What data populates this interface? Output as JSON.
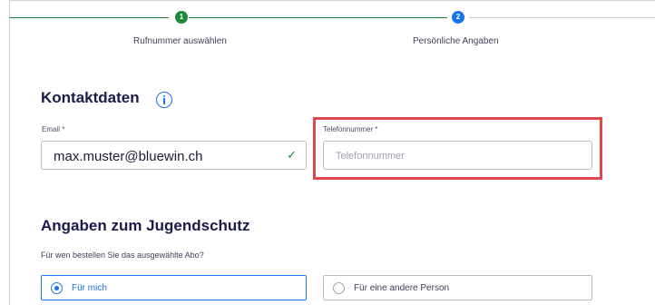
{
  "stepper": {
    "steps": [
      {
        "number": "1",
        "label": "Rufnummer auswählen",
        "state": "done"
      },
      {
        "number": "2",
        "label": "Persönliche Angaben",
        "state": "active"
      }
    ]
  },
  "contact": {
    "heading": "Kontaktdaten",
    "info_icon": "info-icon",
    "email": {
      "label": "Email *",
      "value": "max.muster@bluewin.ch",
      "valid": true
    },
    "phone": {
      "label": "Telefonnummer *",
      "placeholder": "Telefonnummer",
      "value": ""
    }
  },
  "youth": {
    "heading": "Angaben zum Jugendschutz",
    "question": "Für wen bestellen Sie das ausgewählte Abo?",
    "options": [
      {
        "label": "Für mich",
        "selected": true
      },
      {
        "label": "Für eine andere Person",
        "selected": false
      }
    ]
  },
  "colors": {
    "primary": "#1a73e8",
    "success": "#1f8a3b",
    "heading": "#1b1a4b",
    "highlight": "#e0474c"
  }
}
